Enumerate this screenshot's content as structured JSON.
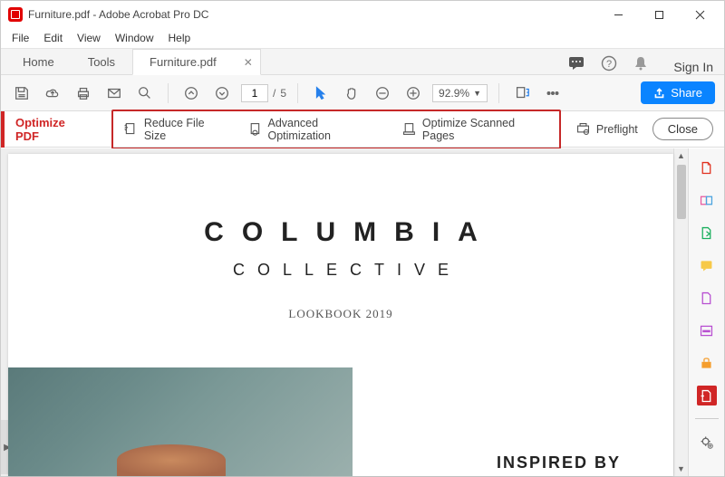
{
  "window": {
    "title": "Furniture.pdf - Adobe Acrobat Pro DC"
  },
  "menu": {
    "items": [
      "File",
      "Edit",
      "View",
      "Window",
      "Help"
    ]
  },
  "tabs": {
    "home": "Home",
    "tools": "Tools",
    "doc": "Furniture.pdf",
    "signin": "Sign In"
  },
  "toolbar": {
    "page_current": "1",
    "page_sep": "/",
    "page_total": "5",
    "zoom": "92.9%",
    "share": "Share"
  },
  "optimize": {
    "title": "Optimize PDF",
    "reduce": "Reduce File Size",
    "advanced": "Advanced Optimization",
    "scanned": "Optimize Scanned Pages",
    "preflight": "Preflight",
    "close": "Close"
  },
  "doc": {
    "t1": "COLUMBIA",
    "t2": "COLLECTIVE",
    "sub": "LOOKBOOK 2019",
    "inspired": "INSPIRED BY"
  }
}
